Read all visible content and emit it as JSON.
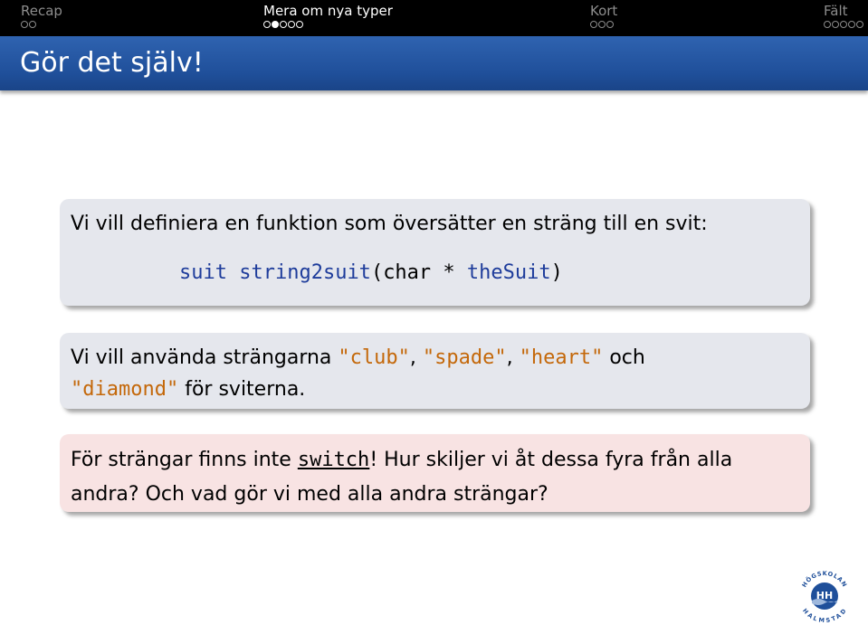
{
  "nav": {
    "sections": [
      {
        "title": "Recap",
        "dots": 2,
        "filled": -1,
        "active": false
      },
      {
        "title": "Mera om nya typer",
        "dots": 5,
        "filled": 1,
        "active": true
      },
      {
        "title": "Kort",
        "dots": 3,
        "filled": -1,
        "active": false
      },
      {
        "title": "Fält",
        "dots": 5,
        "filled": -1,
        "active": false
      }
    ]
  },
  "frame": {
    "title": "Gör det själv!"
  },
  "block1": {
    "text": "Vi vill definiera en funktion som översätter en sträng till en svit:",
    "code": {
      "ret_type": "suit",
      "fn_name": "string2suit",
      "open_paren": "(",
      "param_type": "char",
      "star": " * ",
      "param_name": "theSuit",
      "close_paren": ")"
    }
  },
  "block2": {
    "prefix": "Vi vill använda strängarna",
    "s1": "\"club\"",
    "comma1": ",",
    "s2": "\"spade\"",
    "comma2": ",",
    "s3": "\"heart\"",
    "och": "och",
    "s4": "\"diamond\"",
    "suffix": "för sviterna."
  },
  "block3": {
    "prefix": "För strängar finns inte",
    "keyword": "switch",
    "rest_line1": "! Hur skiljer vi åt dessa fyra från alla",
    "line2": "andra? Och vad gör vi med alla andra strängar?"
  },
  "logo": {
    "top_text": "HÖGSKOLAN",
    "mark_text": "HH",
    "bottom_text": "HALMSTAD",
    "colors": {
      "blue": "#1f4f9a",
      "light": "#9fb8dc"
    }
  }
}
